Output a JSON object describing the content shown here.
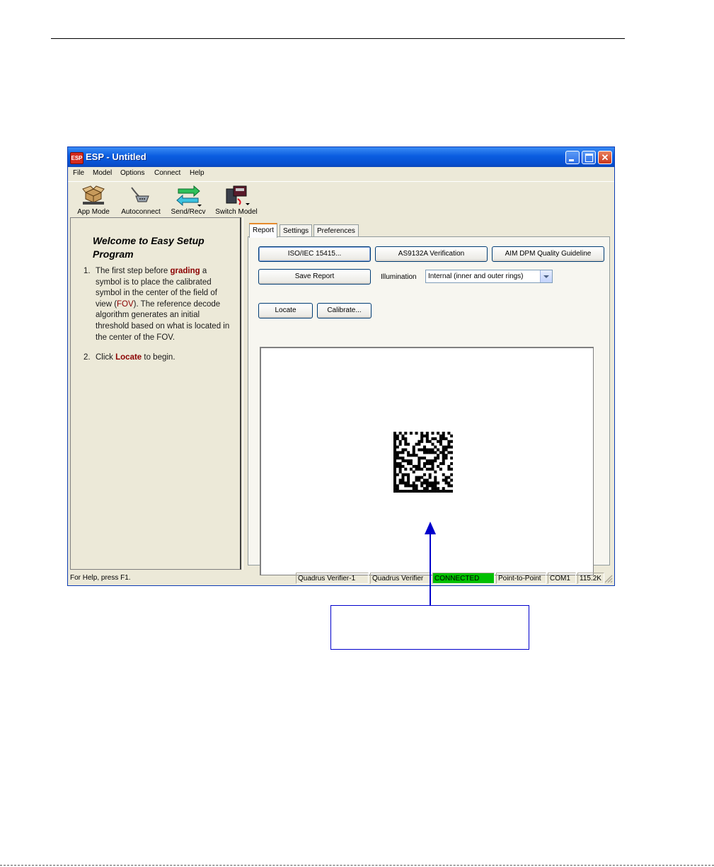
{
  "window": {
    "title": "ESP - Untitled",
    "app_icon_text": "ESP",
    "close_glyph": "✕"
  },
  "menu": [
    "File",
    "Model",
    "Options",
    "Connect",
    "Help"
  ],
  "toolbar": [
    {
      "label": "App Mode",
      "icon": "app-mode-icon"
    },
    {
      "label": "Autoconnect",
      "icon": "autoconnect-icon"
    },
    {
      "label": "Send/Recv",
      "icon": "send-recv-icon"
    },
    {
      "label": "Switch Model",
      "icon": "switch-model-icon"
    }
  ],
  "left_pane": {
    "heading": "Welcome to Easy Setup Program",
    "step1": {
      "num": "1.",
      "pre": "The first step before ",
      "kw": "grading",
      "mid": " a symbol is to place the calibrated symbol in the center of the field of view (",
      "kw2": "FOV",
      "post": "). The reference decode algorithm generates an initial threshold based on what is located in the center of the FOV."
    },
    "step2": {
      "num": "2.",
      "pre": "Click ",
      "kw": "Locate",
      "post": " to begin."
    }
  },
  "tabs": [
    "Report",
    "Settings",
    "Preferences"
  ],
  "buttons": {
    "iso": "ISO/IEC 15415...",
    "as9132a": "AS9132A Verification",
    "aim": "AIM DPM Quality Guideline",
    "save_report": "Save Report",
    "locate": "Locate",
    "calibrate": "Calibrate..."
  },
  "illumination": {
    "label": "Illumination",
    "value": "Internal (inner and outer rings)"
  },
  "statusbar": {
    "help": "For Help, press F1.",
    "model": "Quadrus Verifier-1",
    "device": "Quadrus Verifier",
    "connection": "CONNECTED",
    "connection_color": "#00c000",
    "protocol": "Point-to-Point",
    "port": "COM1",
    "baud": "115.2K"
  },
  "colors": {
    "keyword": "#8b0000",
    "arrow": "#0000cc"
  }
}
